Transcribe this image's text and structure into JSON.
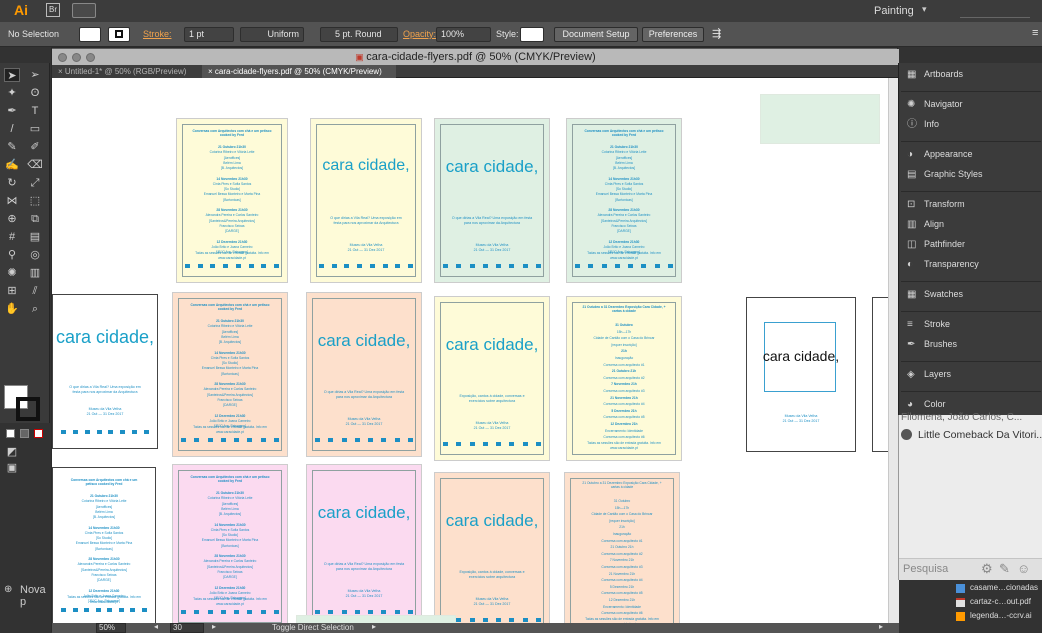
{
  "app": {
    "logo_text": "Ai",
    "bridge_logo_text": "Br",
    "workspace": "Painting"
  },
  "control_bar": {
    "selection": "No Selection",
    "stroke_label": "Stroke:",
    "stroke_value": "1 pt",
    "profile": "Uniform",
    "brush": "5 pt. Round",
    "opacity_label": "Opacity:",
    "opacity_value": "100%",
    "style_label": "Style:",
    "document_setup": "Document Setup",
    "preferences": "Preferences"
  },
  "document": {
    "window_title": "cara-cidade-flyers.pdf @ 50% (CMYK/Preview)",
    "tabs": [
      {
        "label": "Untitled-1* @ 50% (RGB/Preview)",
        "active": false
      },
      {
        "label": "cara-cidade-flyers.pdf @ 50% (CMYK/Preview)",
        "active": true
      }
    ],
    "zoom": "50%",
    "page": "30",
    "status": "Toggle Direct Selection"
  },
  "flyer_text": {
    "title": "cara cidade,",
    "program_header": "Conversas com Arquitectos com chá e um petisco cooked by Fred",
    "program_lines": [
      "21 Outubro 21h30",
      "Cotorina Ribeiro e Vitória Leite",
      "[Aeroffices]",
      "Belém Lima",
      "[B. Arquitectos]",
      "14 Novembro 21h30",
      "Cinta Pires e Sofia Santos",
      "[So Studio]",
      "Emanuel Bessa Monteiro e Marta Pina",
      "[Bortonicas]",
      "28 Novembro 21h30",
      "Alexandra Pereira e Carlos Santeiro",
      "[Santeiros&Pereira Arquitectos]",
      "Francisco Seixas",
      "[DARGE]",
      "12 Dezembro 21h30",
      "João Brito e Joana Carneiro",
      "[JBJC Arq. Paisagem]"
    ],
    "tagline": "O que dirias a Vila Real? Uma exposição em festa para nos aproximar da Arquitectura",
    "tagline_alt": "Exposição, cantos à cidade, conversas e exercícios sobre arquitectura",
    "venue": "Museu da Vila Velha",
    "dates": "21 Out — 31 Dez 2017",
    "footer": "Todas as sessões são de entrada gratuita. Info em www.caracidade.pt",
    "schedule_header": "21 Outubro a 31 Dezembro Exposição Cara Cidade, + cartas à cidade",
    "schedule_lines": [
      "31 Outubro",
      "15h—17h",
      "Cidade de Cantão com o Casa do Brincar",
      "[requer inscrição]",
      "21h",
      "Inauguração",
      "Conversa com arquitecto #1",
      "21 Outubro 21h",
      "Conversa com arquitecto #2",
      "7 Novembro 21h",
      "Conversa com arquitecto #3",
      "21 Novembro 21h",
      "Conversa com arquitecto #4",
      "5 Dezembro 21h",
      "Conversa com arquitecto #5",
      "12 Dezembro 21h",
      "Encerramento: Identidade",
      "Conversa com arquitecto #6"
    ]
  },
  "panels": {
    "items": [
      {
        "label": "Artboards",
        "icon": "artboards-icon"
      },
      {
        "label": "Navigator",
        "icon": "navigator-icon"
      },
      {
        "label": "Info",
        "icon": "info-icon"
      },
      {
        "label": "Appearance",
        "icon": "appearance-icon"
      },
      {
        "label": "Graphic Styles",
        "icon": "graphic-styles-icon"
      },
      {
        "label": "Transform",
        "icon": "transform-icon"
      },
      {
        "label": "Align",
        "icon": "align-icon"
      },
      {
        "label": "Pathfinder",
        "icon": "pathfinder-icon"
      },
      {
        "label": "Transparency",
        "icon": "transparency-icon"
      },
      {
        "label": "Swatches",
        "icon": "swatches-icon"
      },
      {
        "label": "Stroke",
        "icon": "stroke-icon"
      },
      {
        "label": "Brushes",
        "icon": "brushes-icon"
      },
      {
        "label": "Layers",
        "icon": "layers-icon"
      },
      {
        "label": "Color",
        "icon": "color-icon"
      }
    ]
  },
  "messages": {
    "items": [
      "Filomena, João Carlos, C...",
      "Little Comeback Da Vitori..."
    ],
    "search_placeholder": "Pesquisa"
  },
  "desktop": {
    "files": [
      "casame…cionadas",
      "cartaz-c…out.pdf",
      "legenda…-ccrv.ai"
    ],
    "partial_label": "Nova p"
  },
  "colors": {
    "accent_orange": "#f0a24c",
    "flyer_blue": "#1c8fc4",
    "flyer_yellow": "#fefbd8",
    "flyer_green": "#dff0e3",
    "flyer_peach": "#fde0cc",
    "flyer_pink": "#fbdaf0",
    "flyer_white": "#ffffff"
  }
}
